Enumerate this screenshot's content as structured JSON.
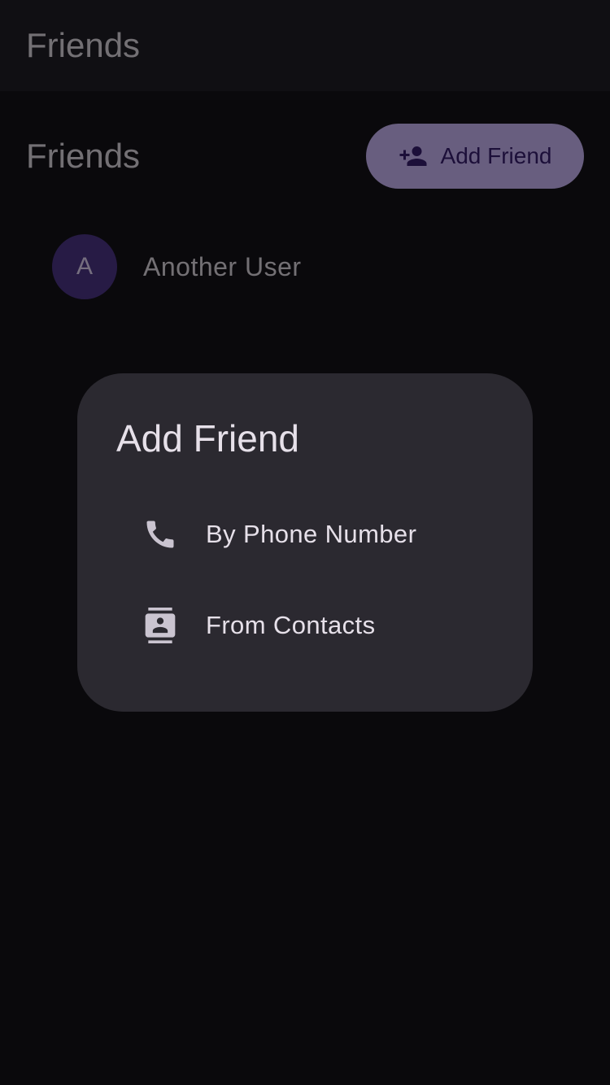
{
  "app_bar": {
    "title": "Friends"
  },
  "section": {
    "title": "Friends",
    "add_button_label": "Add Friend"
  },
  "friends": [
    {
      "initial": "A",
      "name": "Another User"
    }
  ],
  "dialog": {
    "title": "Add Friend",
    "options": [
      {
        "label": "By Phone Number",
        "icon": "phone-icon"
      },
      {
        "label": "From Contacts",
        "icon": "contacts-icon"
      }
    ]
  },
  "colors": {
    "background": "#141218",
    "app_bar": "#211F26",
    "primary_container": "#D0BCFF",
    "avatar": "#4F378B",
    "dialog_surface": "#2B2930"
  }
}
